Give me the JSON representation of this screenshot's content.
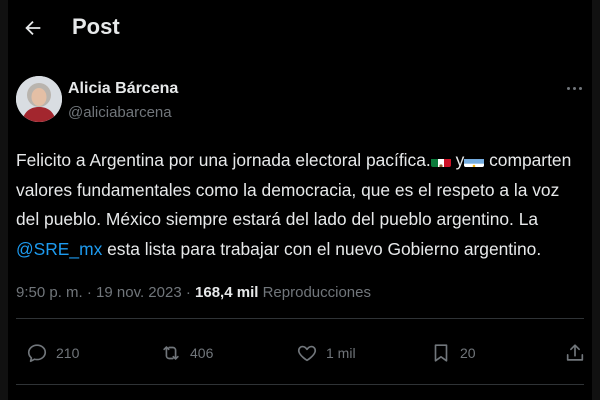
{
  "header": {
    "title": "Post"
  },
  "author": {
    "name": "Alicia Bárcena",
    "handle": "@aliciabarcena"
  },
  "post": {
    "line1_a": "Felicito a Argentina por una jornada electoral pacífica.",
    "line1_b": " y",
    "line1_c": " comparten",
    "line2": "valores fundamentales como la democracia, que es el respeto a la voz",
    "line3": "del pueblo. México siempre estará del lado del pueblo argentino. La",
    "mention": "@SRE_mx",
    "line4_rest": " esta lista para trabajar con el nuevo Gobierno argentino."
  },
  "meta": {
    "time": "9:50 p. m.",
    "sep": " · ",
    "date": "19 nov. 2023",
    "sep2": " · ",
    "views_count": "168,4 mil",
    "views_label": " Reproducciones"
  },
  "actions": {
    "replies": "210",
    "reposts": "406",
    "likes": "1 mil",
    "bookmarks": "20"
  },
  "icons": {
    "back": "arrow-left-icon",
    "more": "more-dots-icon",
    "reply": "reply-icon",
    "repost": "repost-icon",
    "like": "heart-icon",
    "bookmark": "bookmark-icon",
    "share": "share-icon",
    "flag_mx": "mexico-flag-emoji",
    "flag_ar": "argentina-flag-emoji"
  },
  "colors": {
    "background": "#000000",
    "text": "#e7e9ea",
    "muted": "#71767b",
    "link": "#1d9bf0"
  }
}
